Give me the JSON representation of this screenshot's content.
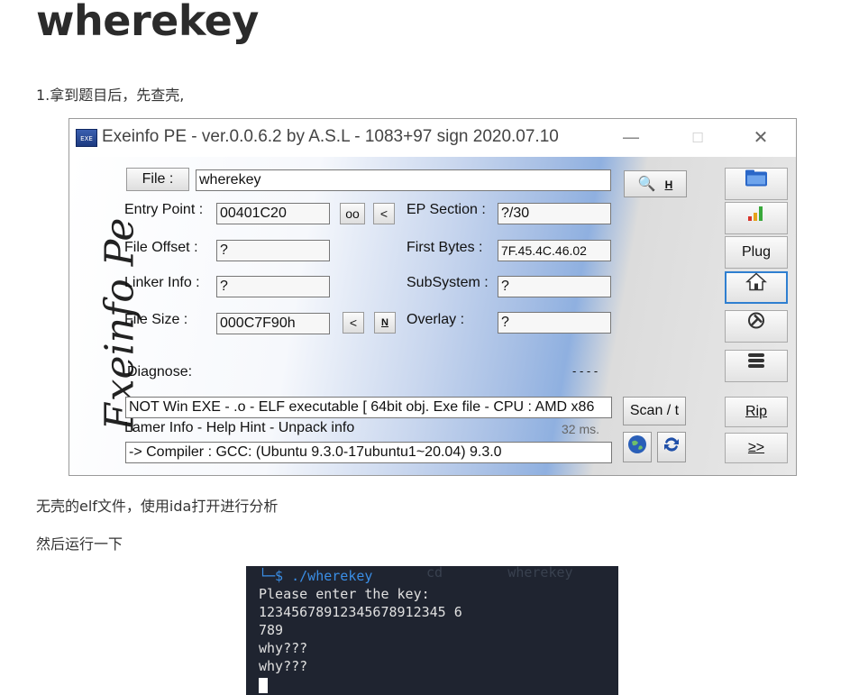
{
  "article": {
    "title": "wherekey",
    "step1": "1.拿到题目后，先查壳,",
    "note1": "无壳的elf文件，使用ida打开进行分析",
    "note2": "然后运行一下"
  },
  "exeinfo": {
    "window_title": "Exeinfo PE - ver.0.0.6.2  by A.S.L -  1083+97 sign  2020.07.10",
    "brand": "Exeinfo Pe",
    "file_button": "File :",
    "file_value": "wherekey",
    "h_button": "H",
    "entry_point_label": "Entry Point :",
    "entry_point_value": "00401C20",
    "oo_button": "oo",
    "lt_button": "<",
    "ep_section_label": "EP Section :",
    "ep_section_value": "?/30",
    "file_offset_label": "File Offset :",
    "file_offset_value": "?",
    "first_bytes_label": "First Bytes :",
    "first_bytes_value": "7F.45.4C.46.02",
    "linker_label": "Linker Info :",
    "linker_value": "?",
    "subsystem_label": "SubSystem :",
    "subsystem_value": "?",
    "file_size_label": "File Size :",
    "file_size_value": "000C7F90h",
    "n_button": "N",
    "overlay_label": "Overlay :",
    "overlay_value": "?",
    "diagnose_label": "Diagnose:",
    "diagnose_dashes": "- - - -",
    "diagnose_value": "NOT Win EXE - .o - ELF executable [ 64bit obj. Exe file - CPU : AMD x86",
    "lamer_info": "Lamer Info - Help Hint - Unpack info",
    "time_ms": "32 ms.",
    "compiler_value": " -> Compiler : GCC: (Ubuntu 9.3.0-17ubuntu1~20.04) 9.3.0",
    "scan_button": "Scan / t",
    "plug_button": "Plug",
    "rip_button": "Rip",
    "next_button": "≥>"
  },
  "terminal": {
    "prompt_prefix": "└─$ ",
    "command": "./wherekey",
    "ghost_text": "cd        wherekey",
    "lines": [
      "Please enter the key:",
      "12345678912345678912345 6",
      "789",
      "why???",
      "why???"
    ],
    "colors": {
      "background": "#1f2430",
      "prompt": "#3a8ee6",
      "text": "#e0e0e0"
    }
  }
}
